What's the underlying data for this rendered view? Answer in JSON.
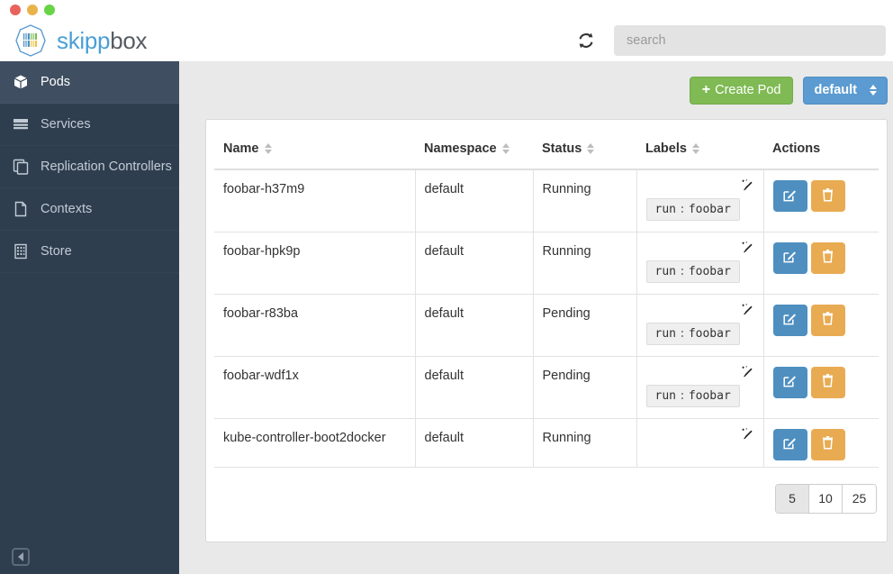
{
  "window": {
    "lights": [
      "close",
      "minimize",
      "zoom"
    ]
  },
  "brand": {
    "part1": "skipp",
    "part2": "box",
    "logo_icon": "skippbox-logo-icon"
  },
  "header": {
    "refresh_icon": "refresh-icon",
    "search": {
      "placeholder": "search",
      "value": ""
    }
  },
  "sidebar": {
    "items": [
      {
        "label": "Pods",
        "icon": "cube-icon",
        "active": true
      },
      {
        "label": "Services",
        "icon": "server-stack-icon",
        "active": false
      },
      {
        "label": "Replication Controllers",
        "icon": "copy-icon",
        "active": false
      },
      {
        "label": "Contexts",
        "icon": "file-icon",
        "active": false
      },
      {
        "label": "Store",
        "icon": "building-icon",
        "active": false
      }
    ],
    "collapse_icon": "collapse-left-icon"
  },
  "toolbar": {
    "create_label": "Create Pod",
    "create_plus": "+",
    "namespace_value": "default",
    "namespace_options": [
      "default"
    ],
    "colors": {
      "create_bg": "#7fba54",
      "namespace_bg": "#5b9bd1"
    }
  },
  "table": {
    "columns": [
      {
        "label": "Name",
        "sortable": true
      },
      {
        "label": "Namespace",
        "sortable": true
      },
      {
        "label": "Status",
        "sortable": true
      },
      {
        "label": "Labels",
        "sortable": true
      },
      {
        "label": "Actions",
        "sortable": false
      }
    ],
    "rows": [
      {
        "name": "foobar-h37m9",
        "namespace": "default",
        "status": "Running",
        "label_key": "run",
        "label_sep": ":",
        "label_value": "foobar",
        "has_label": true,
        "wand_icon": "magic-wand-icon",
        "edit_icon": "edit-icon",
        "delete_icon": "trash-icon"
      },
      {
        "name": "foobar-hpk9p",
        "namespace": "default",
        "status": "Running",
        "label_key": "run",
        "label_sep": ":",
        "label_value": "foobar",
        "has_label": true,
        "wand_icon": "magic-wand-icon",
        "edit_icon": "edit-icon",
        "delete_icon": "trash-icon"
      },
      {
        "name": "foobar-r83ba",
        "namespace": "default",
        "status": "Pending",
        "label_key": "run",
        "label_sep": ":",
        "label_value": "foobar",
        "has_label": true,
        "wand_icon": "magic-wand-icon",
        "edit_icon": "edit-icon",
        "delete_icon": "trash-icon"
      },
      {
        "name": "foobar-wdf1x",
        "namespace": "default",
        "status": "Pending",
        "label_key": "run",
        "label_sep": ":",
        "label_value": "foobar",
        "has_label": true,
        "wand_icon": "magic-wand-icon",
        "edit_icon": "edit-icon",
        "delete_icon": "trash-icon"
      },
      {
        "name": "kube-controller-boot2docker",
        "namespace": "default",
        "status": "Running",
        "label_key": "",
        "label_sep": "",
        "label_value": "",
        "has_label": false,
        "wand_icon": "magic-wand-icon",
        "edit_icon": "edit-icon",
        "delete_icon": "trash-icon"
      }
    ]
  },
  "pagination": {
    "options": [
      "5",
      "10",
      "25"
    ],
    "selected": "5"
  }
}
